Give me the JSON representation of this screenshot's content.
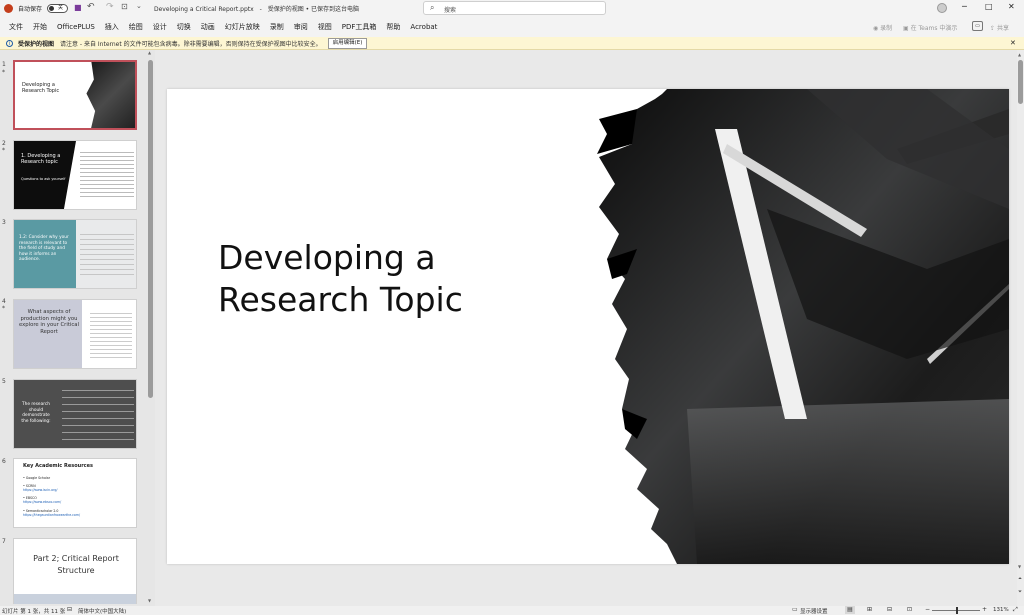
{
  "titlebar": {
    "autosave_label": "自动保存",
    "autosave_state": "关",
    "filename": "Developing a Critical Report.pptx",
    "view_state": "受保护的视图 • 已保存到这台电脑",
    "search_placeholder": "搜索"
  },
  "menu": [
    "文件",
    "开始",
    "OfficePLUS",
    "插入",
    "绘图",
    "设计",
    "切换",
    "动画",
    "幻灯片放映",
    "录制",
    "审阅",
    "视图",
    "PDF工具箱",
    "帮助",
    "Acrobat"
  ],
  "menu_right": {
    "record": "录制",
    "teams": "在 Teams 中演示",
    "share": "共享"
  },
  "infobar": {
    "title": "受保护的视图",
    "message": "请注意 - 来自 Internet 的文件可能包含病毒。除非需要编辑，否则保持在受保护视图中比较安全。",
    "button": "启用编辑(E)"
  },
  "thumbnails": [
    {
      "num": "1",
      "title": "Developing a Research Topic"
    },
    {
      "num": "2",
      "title": "1. Developing a Research topic",
      "subtitle": "Questions to ask yourself"
    },
    {
      "num": "3",
      "title": "1.2: Consider why your research is relevant to the field of study and how it informs an audience."
    },
    {
      "num": "4",
      "title": "What aspects of production might you explore in your Critical Report"
    },
    {
      "num": "5",
      "title": "The research should demonstrate the following:"
    },
    {
      "num": "6",
      "title": "Key Academic Resources",
      "items": [
        "• Google Scholar",
        "• SCRIN",
        "https://www.iscin.org/",
        "• EBSCO",
        "https://www.ebsco.com/",
        "• Semanticscholar 2.0",
        "https://thegaurdianfrowearthe.com/"
      ]
    },
    {
      "num": "7",
      "title": "Part 2; Critical Report Structure"
    }
  ],
  "slide": {
    "title_line1": "Developing a",
    "title_line2": "Research Topic"
  },
  "status": {
    "slide_info": "幻灯片 第 1 张，共 11 张",
    "language": "简体中文(中国大陆)",
    "display_settings": "显示器设置",
    "zoom": "131%"
  }
}
